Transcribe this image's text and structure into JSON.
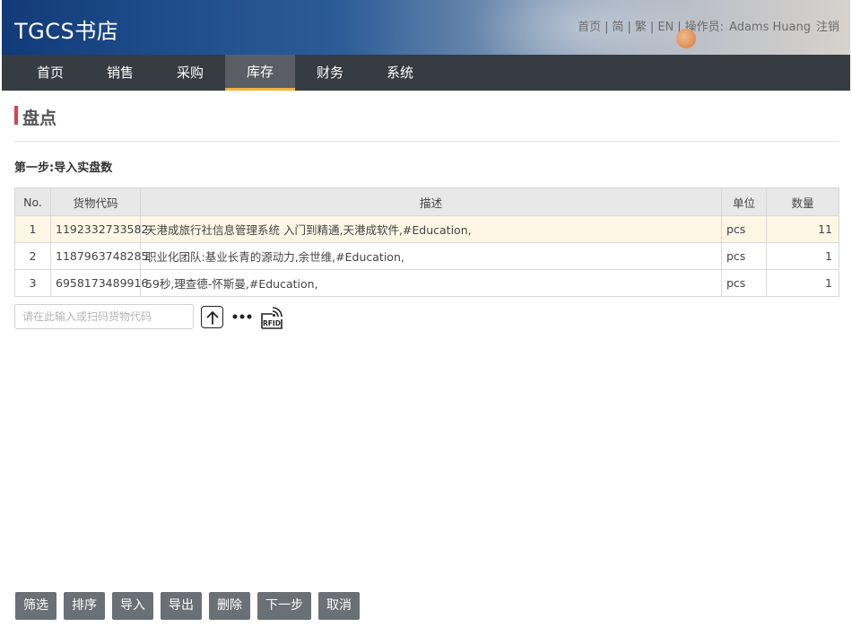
{
  "header": {
    "logo": "TGCS书店",
    "links": [
      "首页",
      "简",
      "繁",
      "EN"
    ],
    "operator_label": "操作员:",
    "operator_name": "Adams Huang",
    "logout": "注销"
  },
  "nav": {
    "items": [
      {
        "label": "首页"
      },
      {
        "label": "销售"
      },
      {
        "label": "采购"
      },
      {
        "label": "库存",
        "active": true
      },
      {
        "label": "财务"
      },
      {
        "label": "系统"
      }
    ],
    "active_color": "#f3b23a"
  },
  "page": {
    "title": "盘点",
    "step_label": "第一步:导入实盘数"
  },
  "table": {
    "columns": [
      "No.",
      "货物代码",
      "描述",
      "单位",
      "数量"
    ],
    "rows": [
      {
        "no": "1",
        "code": "1192332733582",
        "desc": "天港成旅行社信息管理系统 入门到精通,天港成软件,#Education,",
        "unit": "pcs",
        "qty": "11",
        "selected": true
      },
      {
        "no": "2",
        "code": "1187963748285",
        "desc": "职业化团队:基业长青的源动力,余世维,#Education,",
        "unit": "pcs",
        "qty": "1"
      },
      {
        "no": "3",
        "code": "6958173489916",
        "desc": "59秒,理查德-怀斯曼,#Education,",
        "unit": "pcs",
        "qty": "1"
      }
    ]
  },
  "input": {
    "placeholder": "请在此输入或扫码货物代码",
    "value": ""
  },
  "icons": {
    "upload": "arrow-up-icon",
    "more": "more-icon",
    "rfid": "rfid-icon",
    "rfid_text": "RFID"
  },
  "buttons": {
    "filter": "筛选",
    "sort": "排序",
    "import": "导入",
    "export": "导出",
    "delete": "删除",
    "next": "下一步",
    "cancel": "取消"
  },
  "colors": {
    "nav_bg": "#373b42",
    "title_accent": "#d8444b",
    "button_bg": "#6b7076",
    "selected_row": "#fdf6e5"
  }
}
